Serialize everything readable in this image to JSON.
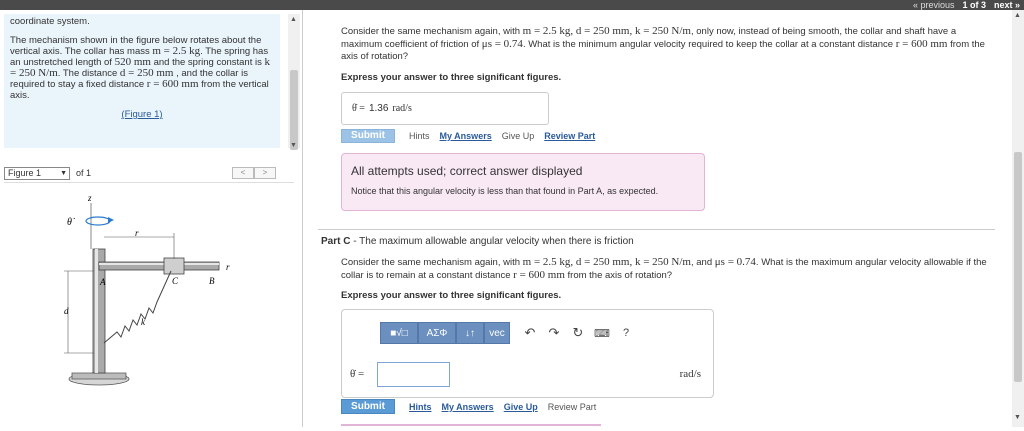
{
  "nav": {
    "previous": "« previous",
    "pager": "1 of 3",
    "next": "next »"
  },
  "left": {
    "intro_tail": "coordinate system.",
    "problem_pre": "The mechanism shown in the figure below rotates about the vertical axis. The collar has mass ",
    "mass": "m = 2.5 kg",
    "problem_mid1": ". The spring has an unstretched length of ",
    "length": "520 mm",
    "problem_mid2": " and the spring constant is ",
    "k": "k = 250 N/m",
    "problem_mid3": ". The distance ",
    "d": "d = 250 mm",
    "problem_mid4": " , and the collar is required to stay a fixed distance ",
    "r": "r = 600 mm",
    "problem_end": " from the vertical axis.",
    "figure_link": "(Figure 1)"
  },
  "figure": {
    "selector": "Figure 1",
    "of": "of 1",
    "prev_btn": "<",
    "next_btn": ">",
    "labels": {
      "z": "z",
      "theta": "θ̇",
      "r_top": "r",
      "r_right": "r",
      "A": "A",
      "C": "C",
      "B": "B",
      "d": "d",
      "k": "k"
    }
  },
  "partB": {
    "q_pre": "Consider the same mechanism again, with ",
    "q_vals": "m = 2.5 kg, d = 250 mm, k = 250 N/m",
    "q_mid": ", only now, instead of being smooth, the collar and shaft have a maximum coefficient of friction of ",
    "mu": "μs = 0.74",
    "q_mid2": ". What is the minimum angular velocity required to keep the collar at a constant distance ",
    "r": "r = 600 mm",
    "q_end": " from the axis of rotation?",
    "instruction": "Express your answer to three significant figures.",
    "answer_symbol": "θ̇ =",
    "answer_value": "1.36",
    "answer_unit": "rad/s",
    "submit": "Submit",
    "links": [
      "Hints",
      "My Answers",
      "Give Up",
      "Review Part"
    ],
    "alert_title": "All attempts used; correct answer displayed",
    "alert_text": "Notice that this angular velocity is less than that found in Part A, as expected."
  },
  "partC": {
    "label": "Part C",
    "title": " - The maximum allowable angular velocity when there is friction",
    "q_pre": "Consider the same mechanism again, with ",
    "q_vals": "m = 2.5 kg, d = 250 mm, k = 250 N/m",
    "q_mid": ", and ",
    "mu": "μs = 0.74",
    "q_mid2": ". What is the maximum angular velocity allowable if the collar is to remain at a constant distance ",
    "r": "r = 600 mm",
    "q_end": " from the axis of rotation?",
    "instruction": "Express your answer to three significant figures.",
    "toolbar": {
      "templates": "■√□",
      "greek": "ΑΣΦ",
      "arrows": "↓↑",
      "vec": "vec",
      "help": "?"
    },
    "answer_symbol": "θ̇ =",
    "answer_value": "",
    "answer_unit": "rad/s",
    "submit": "Submit",
    "links": [
      "Hints",
      "My Answers",
      "Give Up",
      "Review Part"
    ]
  }
}
